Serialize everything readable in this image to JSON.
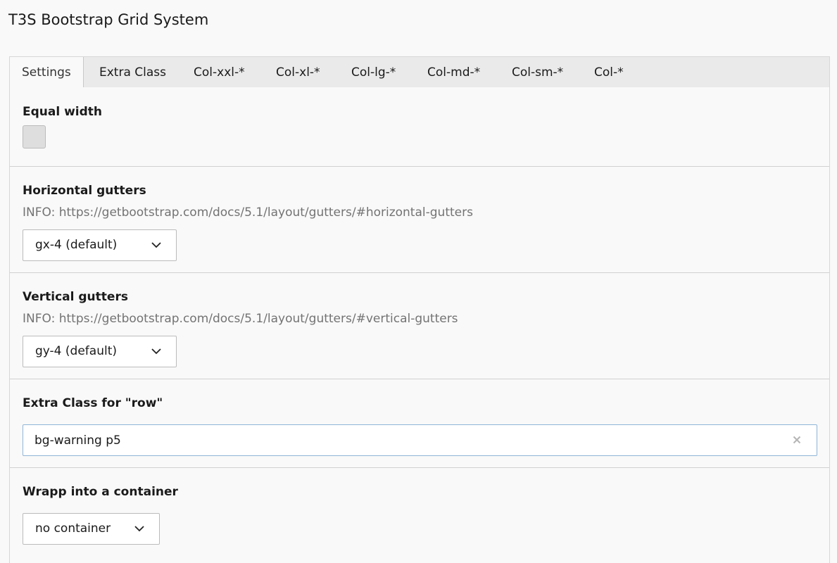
{
  "page": {
    "title": "T3S Bootstrap Grid System"
  },
  "tabs": [
    {
      "label": "Settings",
      "active": true
    },
    {
      "label": "Extra Class",
      "active": false
    },
    {
      "label": "Col-xxl-*",
      "active": false
    },
    {
      "label": "Col-xl-*",
      "active": false
    },
    {
      "label": "Col-lg-*",
      "active": false
    },
    {
      "label": "Col-md-*",
      "active": false
    },
    {
      "label": "Col-sm-*",
      "active": false
    },
    {
      "label": "Col-*",
      "active": false
    }
  ],
  "fields": {
    "equal_width": {
      "label": "Equal width",
      "checked": false
    },
    "horizontal_gutters": {
      "label": "Horizontal gutters",
      "info": "INFO: https://getbootstrap.com/docs/5.1/layout/gutters/#horizontal-gutters",
      "value": "gx-4 (default)"
    },
    "vertical_gutters": {
      "label": "Vertical gutters",
      "info": "INFO: https://getbootstrap.com/docs/5.1/layout/gutters/#vertical-gutters",
      "value": "gy-4 (default)"
    },
    "extra_class_row": {
      "label": "Extra Class for \"row\"",
      "value": "bg-warning p5"
    },
    "container": {
      "label": "Wrapp into a container",
      "value": "no container"
    }
  },
  "icons": {
    "dropdown": "chevron-down-icon",
    "clear": "close-icon"
  },
  "colors": {
    "background": "#f9f9f9",
    "tab_bar": "#eaeaea",
    "input_focus_border": "#8fb5d6",
    "checkbox_fill": "#dedede"
  }
}
